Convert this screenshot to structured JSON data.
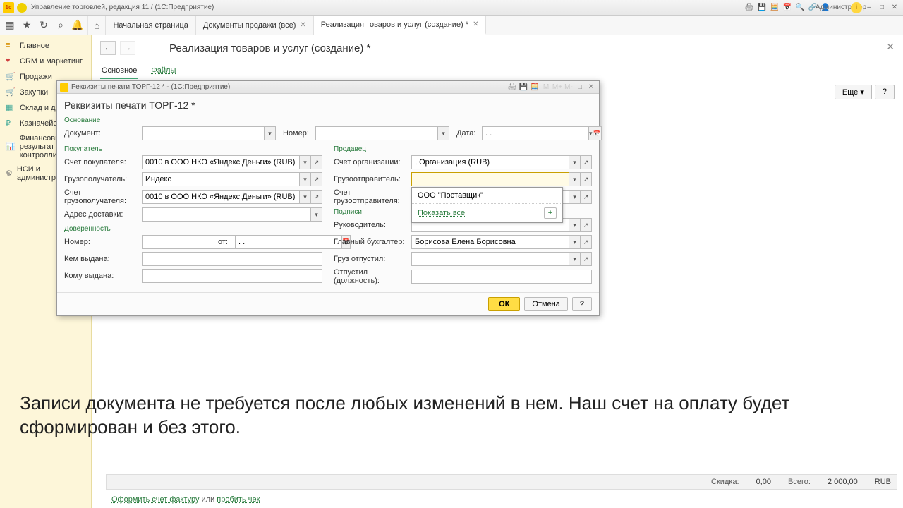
{
  "titlebar": {
    "app": "Управление торговлей, редакция 11 / (1С:Предприятие)",
    "admin": "Администратор"
  },
  "tabs": {
    "home_tooltip": "Начальная страница",
    "t0": "Начальная страница",
    "t1": "Документы продажи (все)",
    "t2": "Реализация товаров и услуг (создание) *"
  },
  "sidebar": {
    "i0": "Главное",
    "i1": "CRM и маркетинг",
    "i2": "Продажи",
    "i3": "Закупки",
    "i4": "Склад и доставка",
    "i5": "Казначейство",
    "i6": "Финансовый результат и контроллинг",
    "i7": "НСИ и администрирование"
  },
  "main": {
    "title": "Реализация товаров и услуг (создание) *",
    "subtab_main": "Основное",
    "subtab_files": "Файлы",
    "more": "Еще",
    "help": "?"
  },
  "dialog": {
    "wintitle": "Реквизиты печати ТОРГ-12 * - (1С:Предприятие)",
    "header": "Реквизиты печати ТОРГ-12 *",
    "sec_base": "Основание",
    "sec_buyer": "Покупатель",
    "sec_seller": "Продавец",
    "sec_auth": "Доверенность",
    "sec_sign": "Подписи",
    "l_document": "Документ:",
    "l_number": "Номер:",
    "l_date": "Дата:",
    "date_val": ". .",
    "l_acc_buyer": "Счет покупателя:",
    "v_acc_buyer": "0010 в ООО НКО «Яндекс.Деньги» (RUB)",
    "l_consignee": "Грузополучатель:",
    "v_consignee": "Индекс",
    "l_acc_consignee": "Счет грузополучателя:",
    "v_acc_consignee": "0010 в ООО НКО «Яндекс.Деньги» (RUB)",
    "l_addr": "Адрес доставки:",
    "l_num2": "Номер:",
    "l_from": "от:",
    "from_val": ". .",
    "l_issued_by": "Кем выдана:",
    "l_issued_to": "Кому выдана:",
    "l_acc_org": "Счет организации:",
    "v_acc_org": ", Организация (RUB)",
    "l_sender": "Грузоотправитель:",
    "l_acc_sender": "Счет грузоотправителя:",
    "l_head": "Руководитель:",
    "l_accountant": "Главный бухгалтер:",
    "v_accountant": "Борисова Елена Борисовна",
    "l_released": "Груз отпустил:",
    "l_released_pos": "Отпустил (должность):",
    "btn_ok": "ОК",
    "btn_cancel": "Отмена",
    "btn_help": "?"
  },
  "dropdown": {
    "opt0": "ООО \"Поставщик\"",
    "showall": "Показать все"
  },
  "caption": "Записи документа не требуется после любых изменений в нем. Наш счет на оплату будет сформирован и без этого.",
  "status": {
    "discount_lbl": "Скидка:",
    "discount_val": "0,00",
    "total_lbl": "Всего:",
    "total_val": "2 000,00",
    "cur": "RUB"
  },
  "footer": {
    "a1": "Оформить счет фактуру",
    "mid": " или ",
    "a2": "пробить чек"
  }
}
